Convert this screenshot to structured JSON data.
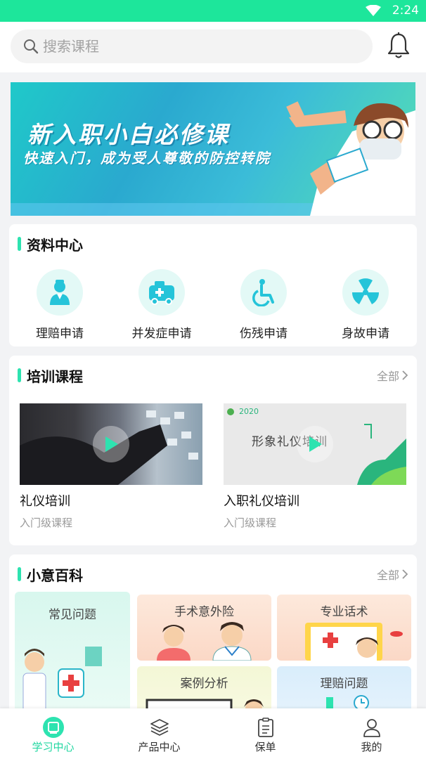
{
  "status_bar": {
    "time": "2:24"
  },
  "search": {
    "placeholder": "搜索课程"
  },
  "banner": {
    "title": "新入职小白必修课",
    "subtitle": "快速入门，成为受人尊敬的防控转院"
  },
  "resource_center": {
    "title": "资料中心",
    "items": [
      {
        "label": "理赔申请",
        "icon": "nurse-icon"
      },
      {
        "label": "并发症申请",
        "icon": "ambulance-icon"
      },
      {
        "label": "伤残申请",
        "icon": "wheelchair-icon"
      },
      {
        "label": "身故申请",
        "icon": "radiation-icon"
      }
    ]
  },
  "training": {
    "title": "培训课程",
    "more": "全部",
    "courses": [
      {
        "name": "礼仪培训",
        "level": "入门级课程"
      },
      {
        "name": "入职礼仪培训",
        "level": "入门级课程",
        "thumb_year": "2020",
        "thumb_text": "形象礼仪培训"
      }
    ]
  },
  "encyclopedia": {
    "title": "小意百科",
    "more": "全部",
    "tiles": [
      {
        "label": "常见问题"
      },
      {
        "label": "手术意外险"
      },
      {
        "label": "专业话术"
      },
      {
        "label": "案例分析"
      },
      {
        "label": "理赔问题"
      }
    ]
  },
  "tabbar": {
    "tabs": [
      {
        "label": "学习中心",
        "active": true
      },
      {
        "label": "产品中心",
        "active": false
      },
      {
        "label": "保单",
        "active": false
      },
      {
        "label": "我的",
        "active": false
      }
    ]
  },
  "colors": {
    "accent": "#1de69b",
    "accent_text": "#1fd7a0",
    "icon_teal": "#25c4d9"
  }
}
